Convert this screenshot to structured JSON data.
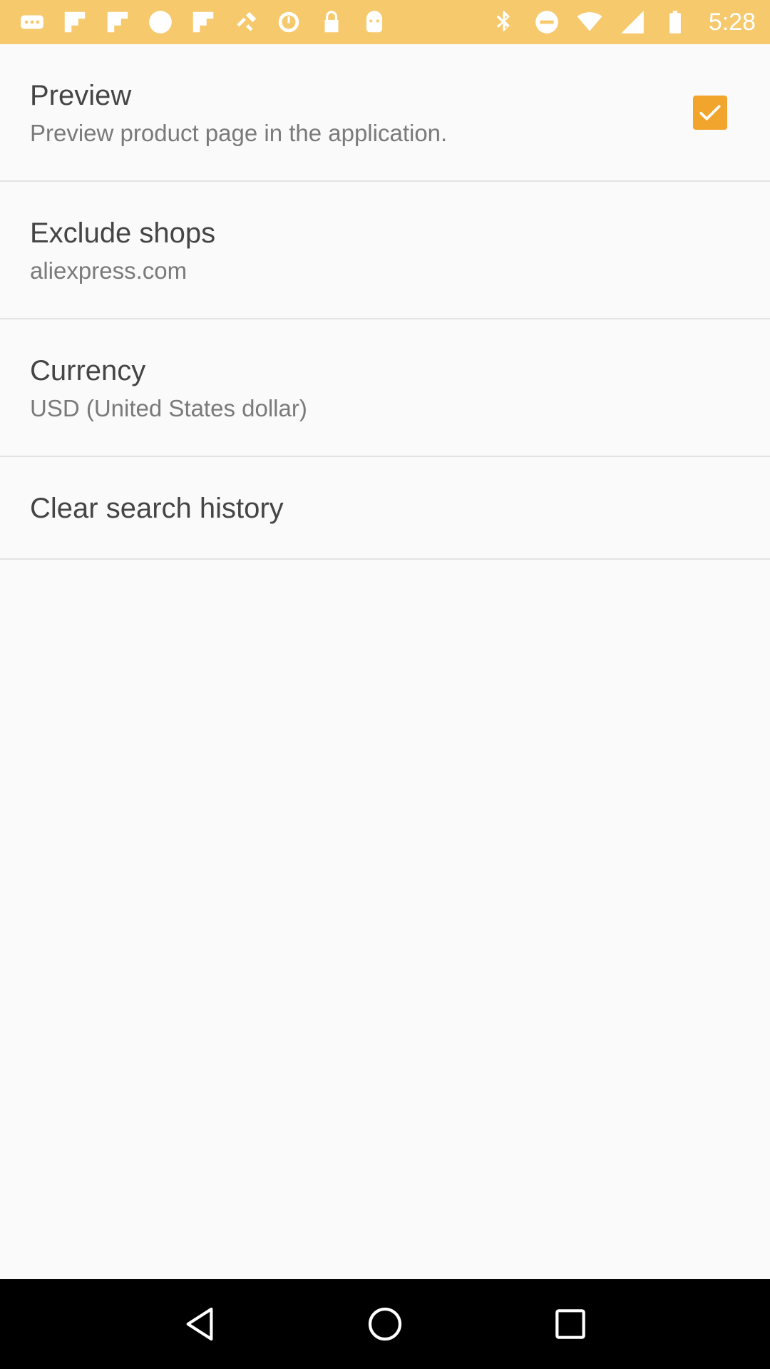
{
  "status_bar": {
    "time": "5:28",
    "left_icons": [
      "more-icon",
      "flipboard-icon",
      "flipboard-icon",
      "circle-icon",
      "flipboard-icon",
      "fake-gps-icon",
      "alarm-icon",
      "lock-icon",
      "android-icon"
    ],
    "right_icons": [
      "bluetooth-icon",
      "dnd-icon",
      "wifi-icon",
      "signal-icon",
      "battery-icon"
    ],
    "background": "#f6c96c"
  },
  "settings": {
    "preview": {
      "title": "Preview",
      "summary": "Preview product page in the application.",
      "checked": true
    },
    "exclude_shops": {
      "title": "Exclude shops",
      "summary": "aliexpress.com"
    },
    "currency": {
      "title": "Currency",
      "summary": "USD (United States dollar)"
    },
    "clear_history": {
      "title": "Clear search history"
    }
  },
  "accent_color": "#f2a52c",
  "nav_bar": {
    "buttons": [
      "back-icon",
      "home-icon",
      "recents-icon"
    ]
  }
}
